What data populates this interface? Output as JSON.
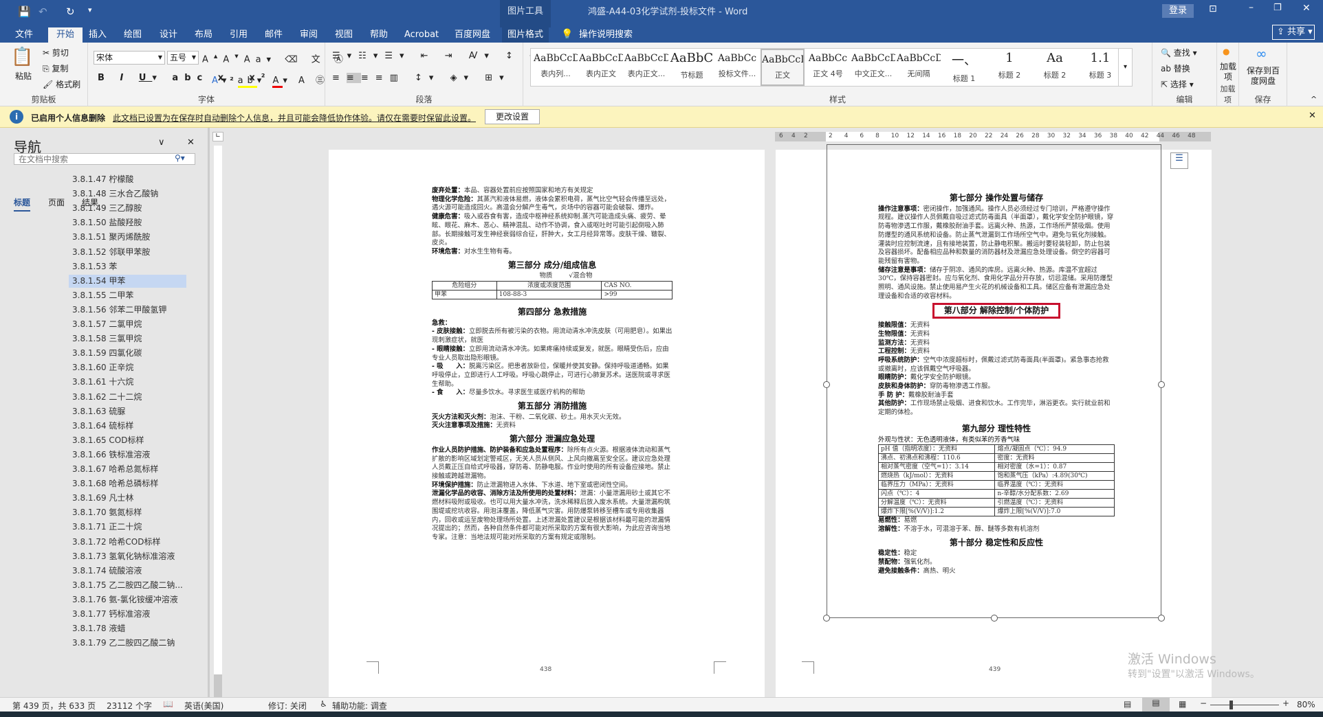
{
  "titlebar": {
    "context_tool": "图片工具",
    "title": "鸿盛-A44-03化学试剂-投标文件  -  Word",
    "login": "登录"
  },
  "tabs": [
    "文件",
    "开始",
    "插入",
    "绘图",
    "设计",
    "布局",
    "引用",
    "邮件",
    "审阅",
    "视图",
    "帮助",
    "Acrobat",
    "百度网盘",
    "图片格式"
  ],
  "tell_me": "操作说明搜索",
  "share": "共享",
  "ribbon": {
    "clipboard": {
      "paste": "粘贴",
      "cut": "剪切",
      "copy": "复制",
      "format_painter": "格式刷",
      "label": "剪贴板"
    },
    "font": {
      "name": "宋体",
      "size": "五号",
      "label": "字体"
    },
    "paragraph": {
      "label": "段落"
    },
    "styles": {
      "label": "样式",
      "items": [
        {
          "preview": "AaBbCcD",
          "name": "表内列..."
        },
        {
          "preview": "AaBbCcDdI",
          "name": "表内正文"
        },
        {
          "preview": "AaBbCcDc",
          "name": "表内正文..."
        },
        {
          "preview": "AaBbC",
          "name": "节标题"
        },
        {
          "preview": "AaBbCc",
          "name": "投标文件..."
        },
        {
          "preview": "AaBbCcDdI",
          "name": "正文"
        },
        {
          "preview": "AaBbCc",
          "name": "正文 4号"
        },
        {
          "preview": "AaBbCcDc",
          "name": "中文正文..."
        },
        {
          "preview": "AaBbCcDdI",
          "name": "无间隔"
        },
        {
          "preview": "一、",
          "name": "标题 1"
        },
        {
          "preview": "1",
          "name": "标题 2"
        },
        {
          "preview": "Aa",
          "name": "标题 2"
        },
        {
          "preview": "1.1",
          "name": "标题 3"
        }
      ]
    },
    "editing": {
      "find": "查找",
      "replace": "替换",
      "select": "选择",
      "label": "编辑"
    },
    "addins": {
      "button": "加载项",
      "label": "加载项"
    },
    "save": {
      "button": "保存到百度网盘",
      "label": "保存"
    }
  },
  "infobar": {
    "title": "已启用个人信息删除",
    "message": "此文档已设置为在保存时自动删除个人信息，并且可能会降低协作体验。请仅在需要时保留此设置。",
    "button": "更改设置"
  },
  "nav": {
    "title": "导航",
    "search_placeholder": "在文档中搜索",
    "tabs": [
      "标题",
      "页面",
      "结果"
    ],
    "items": [
      "3.8.1.47 柠檬酸",
      "3.8.1.48 三水合乙酸钠",
      "3.8.1.49 三乙醇胺",
      "3.8.1.50 盐酸羟胺",
      "3.8.1.51 聚丙烯酰胺",
      "3.8.1.52 邻联甲苯胺",
      "3.8.1.53 苯",
      "3.8.1.54 甲苯",
      "3.8.1.55 二甲苯",
      "3.8.1.56 邻苯二甲酸氢钾",
      "3.8.1.57 二氯甲烷",
      "3.8.1.58 三氯甲烷",
      "3.8.1.59 四氯化碳",
      "3.8.1.60 正辛烷",
      "3.8.1.61 十六烷",
      "3.8.1.62 二十二烷",
      "3.8.1.63 硫脲",
      "3.8.1.64 硫标样",
      "3.8.1.65 COD标样",
      "3.8.1.66 铁标准溶液",
      "3.8.1.67 哈希总氮标样",
      "3.8.1.68 哈希总磷标样",
      "3.8.1.69 凡士林",
      "3.8.1.70 氨氮标样",
      "3.8.1.71 正二十烷",
      "3.8.1.72 哈希COD标样",
      "3.8.1.73 氢氧化钠标准溶液",
      "3.8.1.74 硫酸溶液",
      "3.8.1.75 乙二胺四乙酸二钠...",
      "3.8.1.76 氨-氯化铵缓冲溶液",
      "3.8.1.77 钙标准溶液",
      "3.8.1.78 液蜡",
      "3.8.1.79 乙二胺四乙酸二钠"
    ],
    "selected_index": 7
  },
  "ruler": [
    "6",
    "4",
    "2",
    "2",
    "4",
    "6",
    "8",
    "10",
    "12",
    "14",
    "16",
    "18",
    "20",
    "22",
    "24",
    "26",
    "28",
    "30",
    "32",
    "34",
    "36",
    "38",
    "40",
    "42",
    "44",
    "46",
    "48"
  ],
  "page1": {
    "p1": [
      [
        "废弃处置：",
        "本品、容器处置前应按照国家和地方有关规定"
      ],
      [
        "物理化学危险：",
        "其蒸汽和液体易燃，液体会累积电荷，蒸气比空气轻会传播至远处，遇火源可能造成回火。高温会分解产生毒气，炎场中的容器可能会破裂、爆炸。"
      ],
      [
        "健康危害：",
        "吸入或吞食有害，造成中枢神经系统抑制.蒸汽可能造成头痛、疲劳、晕眩、眼花、麻木、恶心、精神混乱、动作不协调，食入或呕吐时可能引起倒吸入肺部。长期接触可发生神经衰弱综合征，肝肿大，女工月经异常等。皮肤干燥、皲裂、皮炎。"
      ],
      [
        "环境危害：",
        "对水生生物有毒。"
      ]
    ],
    "h3": "第三部分 成分/组成信息",
    "sub": "物质        √混合物",
    "table": [
      [
        "危险组分",
        "浓度或浓度范围",
        "CAS NO."
      ],
      [
        "甲苯",
        "108-88-3",
        ">99"
      ]
    ],
    "h4": "第四部分 急救措施",
    "p4": [
      [
        "急救：",
        ""
      ],
      [
        "- 皮肤接触：",
        "立即脱去所有被污染的衣物。用流动清水冲洗皮肤（可用肥皂）。如果出现刺激症状，就医"
      ],
      [
        "- 眼睛接触：",
        "立即用流动清水冲洗。如果疼痛持续或复发，就医。眼睛受伤后，应由专业人员取出隐形眼镜。"
      ],
      [
        "- 吸　　入：",
        "脱离污染区。把患者放卧位，保暖并使其安静。保持呼吸道通畅。如果呼吸停止，立即进行人工呼吸。呼吸心跳停止，可进行心肺复苏术。送医院或寻求医生帮助。"
      ],
      [
        "- 食　　入：",
        "尽量多饮水。寻求医生或医疗机构的帮助"
      ]
    ],
    "h5": "第五部分 消防措施",
    "p5": [
      [
        "灭火方法和灭火剂：",
        "泡沫、干粉、二氧化碳、砂土。用水灭火无效。"
      ],
      [
        "灭火注意事项及措施：",
        "无资料"
      ]
    ],
    "h6": "第六部分 泄漏应急处理",
    "p6": [
      [
        "作业人员防护措施、防护装备和应急处置程序：",
        "除所有点火源。根据液体流动和蒸气扩散的影响区域划定警戒区，无关人员从侧风、上风向撤离至安全区。建议应急处理人员戴正压自给式呼吸器，穿防毒、防静电服。作业时使用的所有设备应接地。禁止接触或跨越泄漏物。"
      ],
      [
        "环境保护措施：",
        "防止泄漏物进入水体、下水道、地下室或密闭性空间。"
      ],
      [
        "泄漏化学品的收容、消除方法及所使用的处置材料：",
        "泄漏：小量泄漏用砂土或其它不燃材料吸附或吸收。也可以用大量水冲洗，洗水稀释后放入废水系统。大量泄漏构筑围堤或挖坑收容。用泡沫覆盖，降低蒸气灾害。用防爆泵转移至槽车或专用收集器内，回收或运至废物处理场所处置。上述泄漏处置建议是根据该材料最可能的泄漏情况提出的；然而，各种自然条件都可能对所采取的方案有很大影响，为此应咨询当地专家。注意：当地法规可能对所采取的方案有规定或限制。"
      ]
    ],
    "page_number": "438"
  },
  "page2": {
    "h7": "第七部分 操作处置与储存",
    "p7": [
      [
        "操作注意事项：",
        "密闭操作，加强通风。操作人员必须经过专门培训，严格遵守操作规程。建议操作人员佩戴自吸过滤式防毒面具（半面罩），戴化学安全防护眼镜，穿防毒物渗透工作服，戴橡胶耐油手套。远离火种、热源，工作场所严禁吸烟。使用防爆型的通风系统和设备。防止蒸气泄漏到工作场所空气中。避免与氧化剂接触。灌装时应控制流速，且有接地装置，防止静电积聚。搬运时要轻装轻卸，防止包装及容器损坏。配备相应品种和数量的消防器材及泄漏应急处理设备。倒空的容器可能残留有害物。"
      ],
      [
        "储存注意是事项：",
        "储存于阴凉、通风的库房。远离火种、热源。库温不宜超过30℃，保持容器密封。应与氧化剂、食用化学品分开存放，切忌混储。采用防爆型照明、通风设施。禁止使用易产生火花的机械设备和工具。储区应备有泄漏应急处理设备和合适的收容材料。"
      ]
    ],
    "h8": "第八部分 解除控制/个体防护",
    "p8": [
      [
        "接触限值：",
        "无资料"
      ],
      [
        "生物限值：",
        "无资料"
      ],
      [
        "监测方法：",
        "无资料"
      ],
      [
        "工程控制：",
        "无资料"
      ],
      [
        "呼吸系统防护：",
        "空气中浓度超标时，佩戴过滤式防毒面具(半面罩)。紧急事态抢救或撤离时，应该佩戴空气呼吸器。"
      ],
      [
        "眼睛防护：",
        "戴化学安全防护眼镜。"
      ],
      [
        "皮肤和身体防护：",
        "穿防毒物渗透工作服。"
      ],
      [
        "手 防 护：",
        "戴橡胶耐油手套"
      ],
      [
        "其他防护：",
        "工作现场禁止吸烟、进食和饮水。工作完毕，淋浴更衣。实行就业前和定期的体检。"
      ]
    ],
    "h9": "第九部分 理性特性",
    "appearance": "外观与性状：无色透明液体，有类似苯的芳香气味",
    "table": [
      [
        "pH 值（指明浓度）：无资料",
        "熔点/凝固点（℃）：94.9"
      ],
      [
        "沸点、初沸点和沸程：110.6",
        "密度：无资料"
      ],
      [
        "相对蒸气密度（空气=1）：3.14",
        "相对密度（水=1）：0.87"
      ],
      [
        "燃烧热（kJ/mol）：无资料",
        "饱和蒸气压（kPa）:4.89(30℃)"
      ],
      [
        "临界压力（MPa）：无资料",
        "临界温度（℃）：无资料"
      ],
      [
        "闪点（℃）：4",
        "n-辛醇/水分配系数：2.69"
      ],
      [
        "分解温度（℃）：无资料",
        "引燃温度（℃）：无资料"
      ],
      [
        "爆炸下限[%(V/V)]:1.2",
        "爆炸上限[%(V/V)]:7.0"
      ]
    ],
    "p9": [
      [
        "易燃性：",
        "易燃"
      ],
      [
        "溶解性：",
        "不溶于水，可混溶于苯、醇、醚等多数有机溶剂"
      ]
    ],
    "h10": "第十部分 稳定性和反应性",
    "p10": [
      [
        "稳定性：",
        "稳定"
      ],
      [
        "禁配物：",
        "强氧化剂。"
      ],
      [
        "避免接触条件：",
        "高热、明火"
      ]
    ],
    "page_number": "439"
  },
  "status": {
    "page": "第 439 页，共 633 页",
    "words": "23112 个字",
    "language": "英语(美国)",
    "track": "修订: 关闭",
    "accessibility": "辅助功能: 调查",
    "zoom": "80%",
    "zoom_value": 80
  },
  "watermark": {
    "line1": "激活 Windows",
    "line2": "转到\"设置\"以激活 Windows。"
  },
  "colors": {
    "brand": "#2b579a",
    "highlight": "#c8102e",
    "infobar": "#fcf4be"
  }
}
